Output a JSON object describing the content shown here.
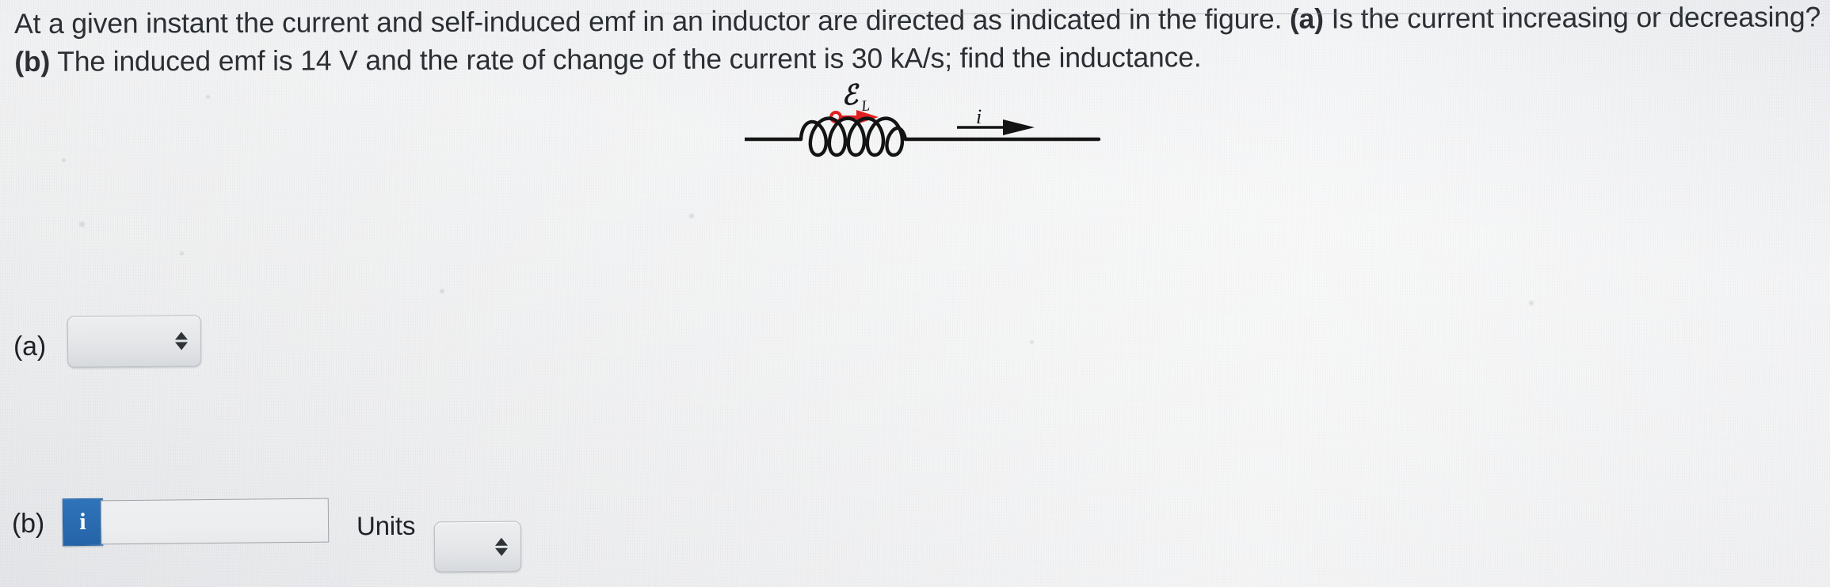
{
  "problem": {
    "line1_part1": "At a given instant the current and self-induced emf in an inductor are directed as indicated in the figure. ",
    "line1_bold_a": "(a)",
    "line1_part2": " Is the current increasing or decreasing? ",
    "line2_bold_b": "(b)",
    "line2_part2": " The induced emf is 14 V and the rate of change of the current is 30 kA/s; find the inductance.",
    "emf_value": "14 V",
    "rate_of_change": "30 kA/s"
  },
  "figure": {
    "emf_label": "ℰ",
    "emf_subscript": "L",
    "current_label": "i",
    "emf_arrow_color": "#e02020",
    "wire_color": "#1a1a1a",
    "coil_turns": 5,
    "emf_arrow_direction": "right",
    "current_arrow_direction": "right"
  },
  "answers": {
    "part_a": {
      "label": "(a)",
      "select_value": "",
      "select_placeholder": ""
    },
    "part_b": {
      "label": "(b)",
      "info_icon": "i",
      "input_value": "",
      "input_placeholder": "",
      "units_label": "Units",
      "units_value": "",
      "units_placeholder": ""
    }
  },
  "colors": {
    "info_button_blue": "#2a6bb0",
    "emf_red": "#e02020",
    "page_background": "#eceef0",
    "text": "#2b2f33"
  }
}
